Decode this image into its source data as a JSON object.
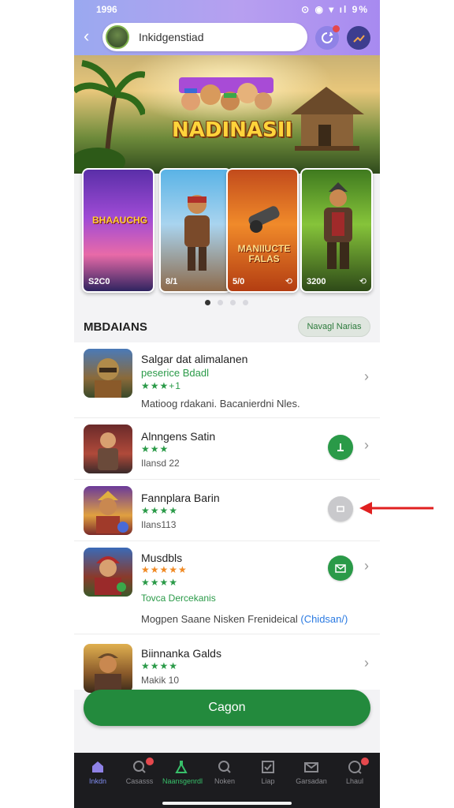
{
  "status": {
    "time": "1996",
    "right": "⊙ ◉ ▾ ıl 9%"
  },
  "header": {
    "search_text": "Inkidgenstiad"
  },
  "banner": {
    "title": "NADINASII"
  },
  "carousel": {
    "cards": [
      {
        "title": "BHAAUCHG",
        "label": "S2C0",
        "icon": ""
      },
      {
        "title": "",
        "label": "8/1",
        "icon": ""
      },
      {
        "title": "MANIIUCTE FALAS",
        "label": "5/0",
        "icon": "refresh-icon"
      },
      {
        "title": "",
        "label": "3200",
        "icon": "refresh-icon"
      }
    ]
  },
  "section": {
    "title": "MBDAIANS",
    "button": "Navagl Narias"
  },
  "list": [
    {
      "name": "Salgar dat alimalanen",
      "subtitle": "peserice Bdadl",
      "stars": "★★★+1",
      "description": "Matioog rdakani. Bacanierdni Nles."
    },
    {
      "name": "Alnngens Satin",
      "stars": "★★★",
      "meta": "Ilansd 22"
    },
    {
      "name": "Fannplara Barin",
      "stars": "★★★★",
      "meta": "Ilans113"
    },
    {
      "name": "Musdbls",
      "stars_orange": "★★★★★",
      "stars": "★★★★",
      "meta": "Tovca Dercekanis",
      "description": "Mogpen Saane Nisken Frenideical",
      "link": "(Chidsan/)"
    },
    {
      "name": "Biinnanka Galds",
      "stars": "★★★★",
      "meta": "Makik 10"
    }
  ],
  "cta": {
    "label": "Cagon"
  },
  "nav": [
    {
      "label": "Inkdn",
      "icon": "home-icon"
    },
    {
      "label": "Casasss",
      "icon": "search-circle-icon"
    },
    {
      "label": "Naansgenrdl",
      "icon": "flask-icon"
    },
    {
      "label": "Noken",
      "icon": "search-icon"
    },
    {
      "label": "Liap",
      "icon": "checkbox-icon"
    },
    {
      "label": "Garsadan",
      "icon": "mail-icon"
    },
    {
      "label": "Lhaul",
      "icon": "chat-icon"
    }
  ],
  "colors": {
    "accent": "#238a3d",
    "header": "#a78af0",
    "nav_bg": "#1c1c1f"
  }
}
